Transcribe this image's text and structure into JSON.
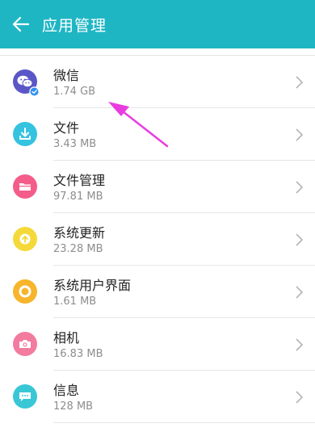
{
  "header": {
    "title": "应用管理",
    "back_icon": "arrow-left-icon"
  },
  "colors": {
    "appbar": "#1fb6c4",
    "annotation_arrow": "#e83ce0"
  },
  "apps": [
    {
      "name": "微信",
      "size": "1.74 GB",
      "icon": "wechat-icon",
      "icon_color": "#5b56c8",
      "badge": "verified-shield-icon"
    },
    {
      "name": "文件",
      "size": "3.43 MB",
      "icon": "download-icon",
      "icon_color": "#35c3e0"
    },
    {
      "name": "文件管理",
      "size": "97.81 MB",
      "icon": "folder-icon",
      "icon_color": "#f45d8a"
    },
    {
      "name": "系统更新",
      "size": "23.28 MB",
      "icon": "update-arrow-icon",
      "icon_color": "#f5d93a"
    },
    {
      "name": "系统用户界面",
      "size": "1.61 MB",
      "icon": "circle-icon",
      "icon_color": "#f7b52c"
    },
    {
      "name": "相机",
      "size": "16.83 MB",
      "icon": "camera-icon",
      "icon_color": "#f27ba0"
    },
    {
      "name": "信息",
      "size": "128 MB",
      "icon": "message-icon",
      "icon_color": "#39c7d6"
    }
  ]
}
